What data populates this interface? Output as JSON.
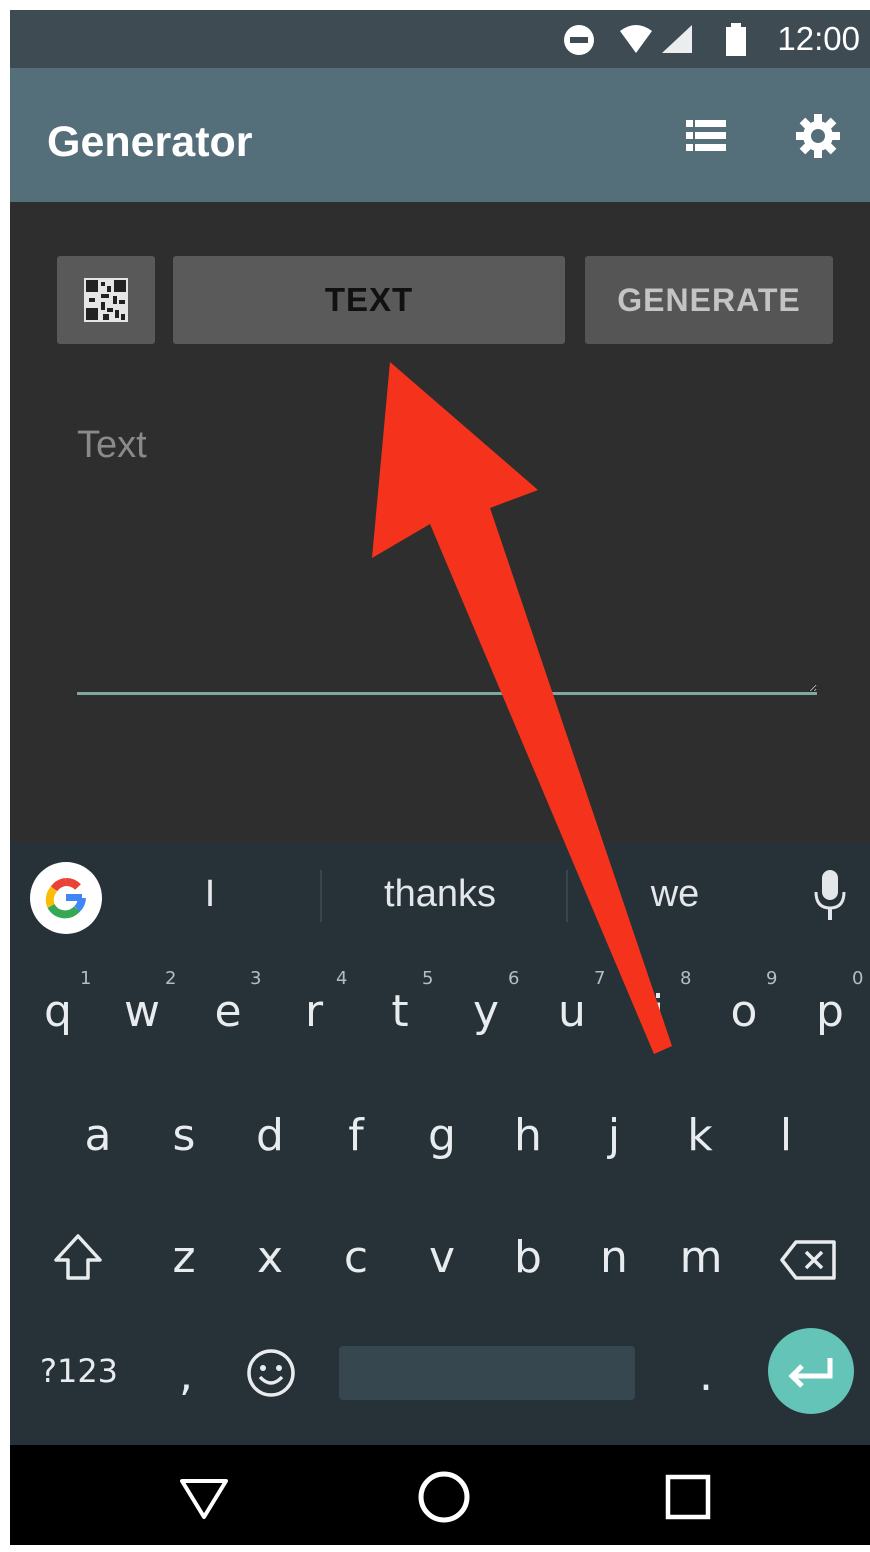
{
  "status_bar": {
    "time": "12:00"
  },
  "app_bar": {
    "title": "Generator"
  },
  "toolbar": {
    "type_label": "TEXT",
    "generate_label": "GENERATE"
  },
  "input": {
    "placeholder": "Text"
  },
  "keyboard": {
    "suggestions": [
      "I",
      "thanks",
      "we"
    ],
    "row1": [
      {
        "key": "q",
        "hint": "1"
      },
      {
        "key": "w",
        "hint": "2"
      },
      {
        "key": "e",
        "hint": "3"
      },
      {
        "key": "r",
        "hint": "4"
      },
      {
        "key": "t",
        "hint": "5"
      },
      {
        "key": "y",
        "hint": "6"
      },
      {
        "key": "u",
        "hint": "7"
      },
      {
        "key": "i",
        "hint": "8"
      },
      {
        "key": "o",
        "hint": "9"
      },
      {
        "key": "p",
        "hint": "0"
      }
    ],
    "row2": [
      "a",
      "s",
      "d",
      "f",
      "g",
      "h",
      "j",
      "k",
      "l"
    ],
    "row3": [
      "z",
      "x",
      "c",
      "v",
      "b",
      "n",
      "m"
    ],
    "symbols_label": "?123",
    "comma": ",",
    "period": "."
  },
  "annotation": {
    "arrow_color": "#f5331c"
  },
  "colors": {
    "app_bar": "#546e7a",
    "status_bar": "#3e4b52",
    "keyboard": "#263238",
    "enter": "#64c4b7"
  }
}
